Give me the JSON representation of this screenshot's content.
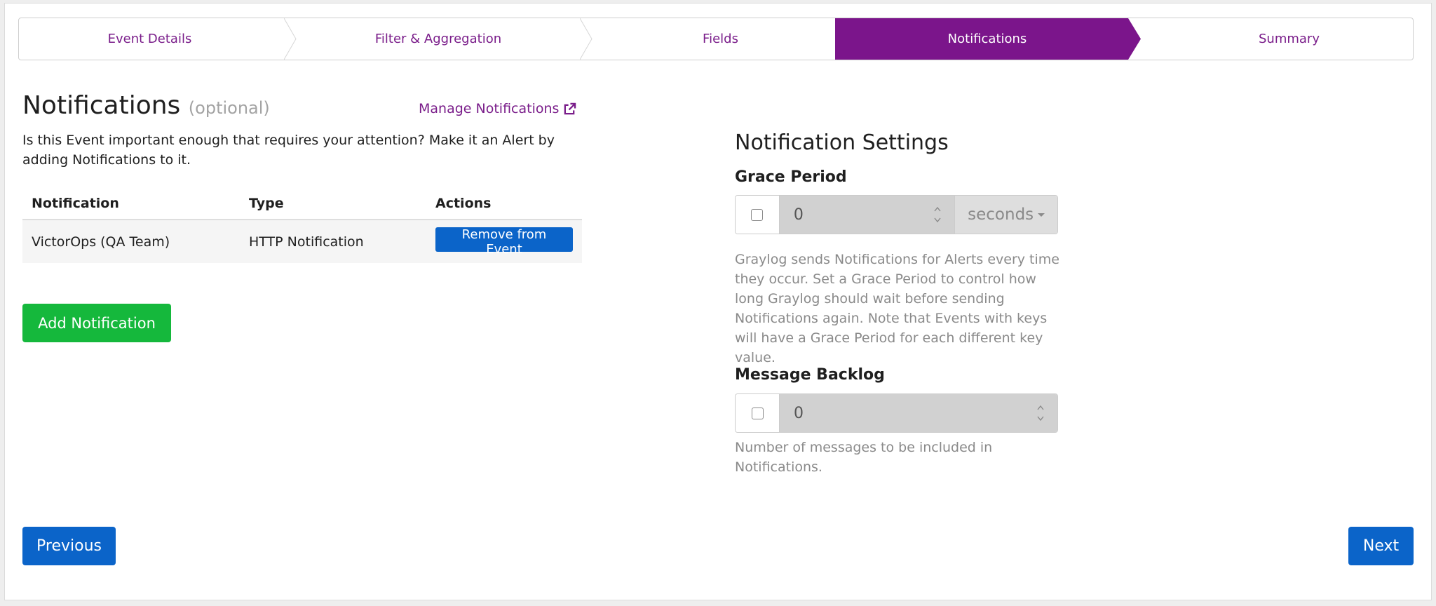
{
  "wizard": {
    "steps": [
      {
        "label": "Event Details",
        "active": false
      },
      {
        "label": "Filter & Aggregation",
        "active": false
      },
      {
        "label": "Fields",
        "active": false
      },
      {
        "label": "Notifications",
        "active": true
      },
      {
        "label": "Summary",
        "active": false
      }
    ],
    "accent_color": "#7b158b"
  },
  "notifications": {
    "title": "Notifications",
    "optional": "(optional)",
    "manage_link": "Manage Notifications",
    "description": "Is this Event important enough that requires your attention? Make it an Alert by adding Notifications to it.",
    "table": {
      "headers": [
        "Notification",
        "Type",
        "Actions"
      ],
      "rows": [
        {
          "notification": "VictorOps (QA Team)",
          "type": "HTTP Notification",
          "action": "Remove from Event"
        }
      ]
    },
    "add_button": "Add Notification"
  },
  "settings": {
    "title": "Notification Settings",
    "grace_period": {
      "label": "Grace Period",
      "value": "0",
      "unit": "seconds",
      "checked": false,
      "help": "Graylog sends Notifications for Alerts every time they occur. Set a Grace Period to control how long Graylog should wait before sending Notifications again. Note that Events with keys will have a Grace Period for each different key value."
    },
    "message_backlog": {
      "label": "Message Backlog",
      "value": "0",
      "checked": false,
      "help": "Number of messages to be included in Notifications."
    }
  },
  "nav": {
    "previous": "Previous",
    "next": "Next"
  },
  "icons": {
    "manage_link_icon": "external-link-icon",
    "spinner_icon": "spinner-arrows-icon",
    "caret_icon": "caret-down-icon"
  }
}
